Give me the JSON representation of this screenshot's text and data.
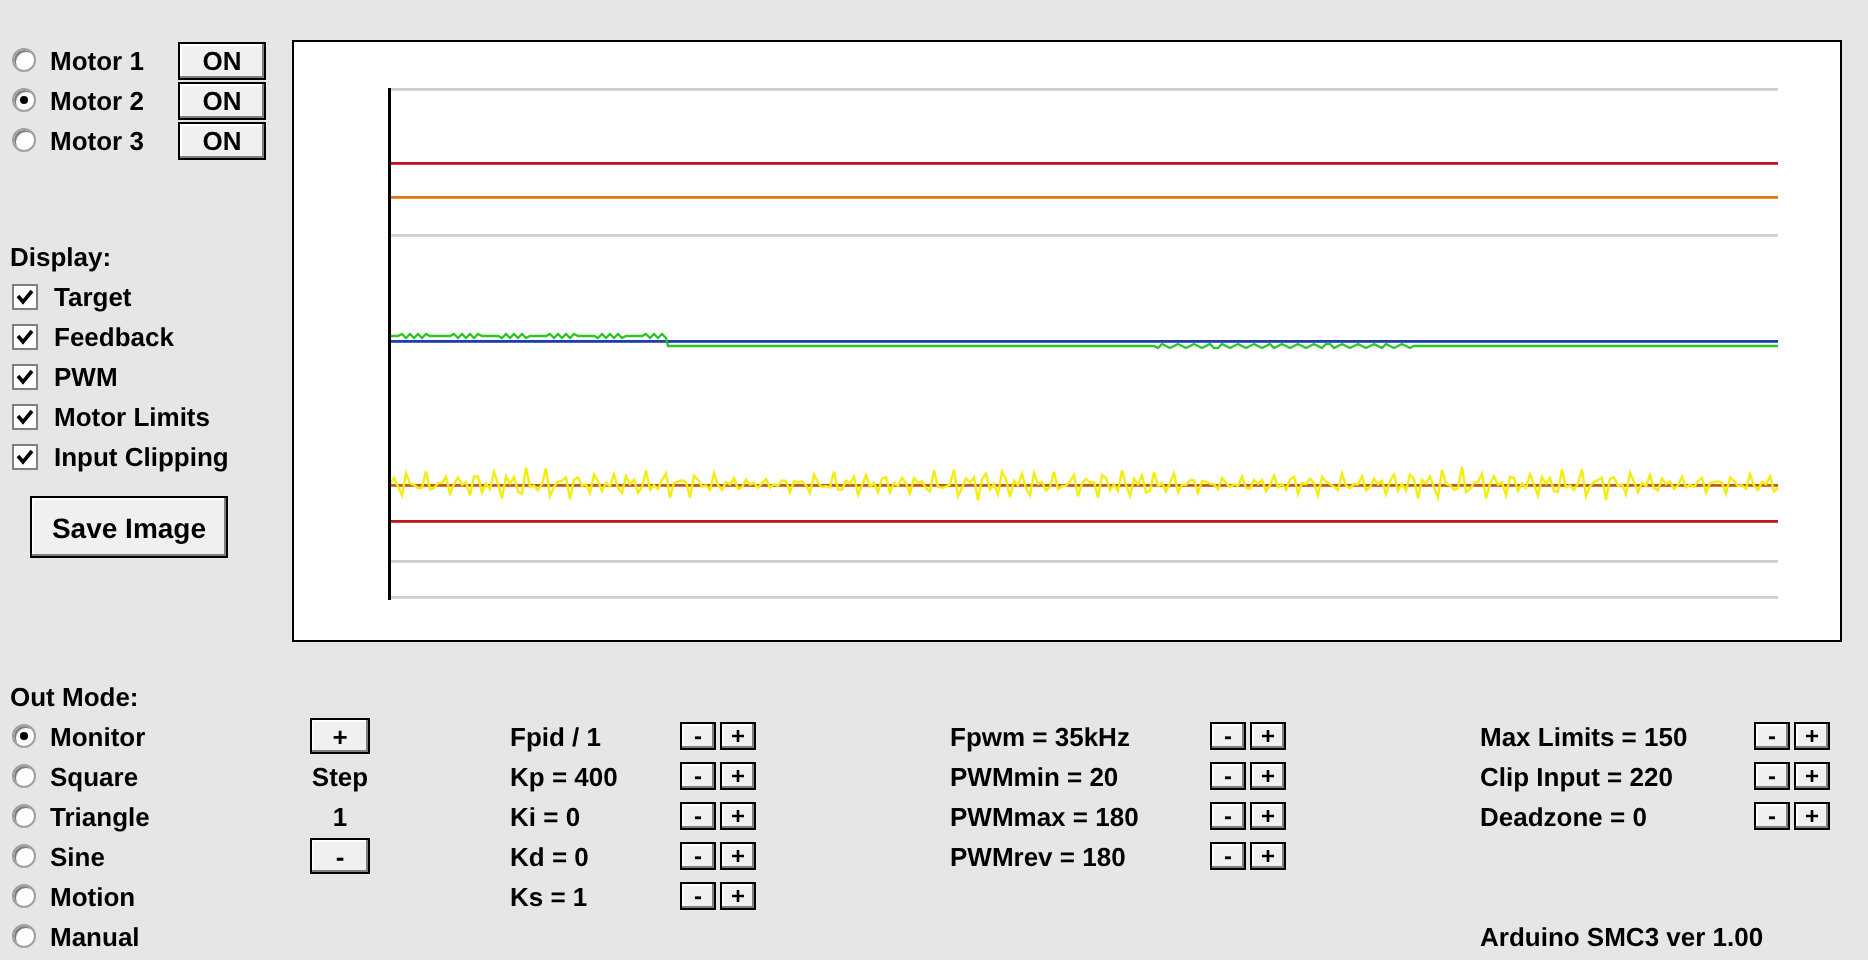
{
  "motors": [
    {
      "label": "Motor 1",
      "selected": false,
      "button": "ON"
    },
    {
      "label": "Motor 2",
      "selected": true,
      "button": "ON"
    },
    {
      "label": "Motor 3",
      "selected": false,
      "button": "ON"
    }
  ],
  "display": {
    "title": "Display:",
    "options": [
      {
        "label": "Target",
        "checked": true
      },
      {
        "label": "Feedback",
        "checked": true
      },
      {
        "label": "PWM",
        "checked": true
      },
      {
        "label": "Motor Limits",
        "checked": true
      },
      {
        "label": "Input Clipping",
        "checked": true
      }
    ]
  },
  "save_button": "Save Image",
  "out_mode": {
    "title": "Out Mode:",
    "options": [
      {
        "label": "Monitor",
        "selected": true
      },
      {
        "label": "Square",
        "selected": false
      },
      {
        "label": "Triangle",
        "selected": false
      },
      {
        "label": "Sine",
        "selected": false
      },
      {
        "label": "Motion",
        "selected": false
      },
      {
        "label": "Manual",
        "selected": false
      }
    ]
  },
  "step": {
    "plus": "+",
    "label": "Step",
    "value": "1",
    "minus": "-"
  },
  "parameter_columns": [
    [
      {
        "label": "Fpid / 1",
        "minus": "-",
        "plus": "+"
      },
      {
        "label": "Kp = 400",
        "minus": "-",
        "plus": "+"
      },
      {
        "label": "Ki = 0",
        "minus": "-",
        "plus": "+"
      },
      {
        "label": "Kd = 0",
        "minus": "-",
        "plus": "+"
      },
      {
        "label": "Ks = 1",
        "minus": "-",
        "plus": "+"
      }
    ],
    [
      {
        "label": "Fpwm = 35kHz",
        "minus": "-",
        "plus": "+"
      },
      {
        "label": "PWMmin = 20",
        "minus": "-",
        "plus": "+"
      },
      {
        "label": "PWMmax = 180",
        "minus": "-",
        "plus": "+"
      },
      {
        "label": "PWMrev = 180",
        "minus": "-",
        "plus": "+"
      }
    ],
    [
      {
        "label": "Max Limits = 150",
        "minus": "-",
        "plus": "+"
      },
      {
        "label": "Clip Input = 220",
        "minus": "-",
        "plus": "+"
      },
      {
        "label": "Deadzone = 0",
        "minus": "-",
        "plus": "+"
      }
    ]
  ],
  "version": "Arduino SMC3 ver 1.00"
}
